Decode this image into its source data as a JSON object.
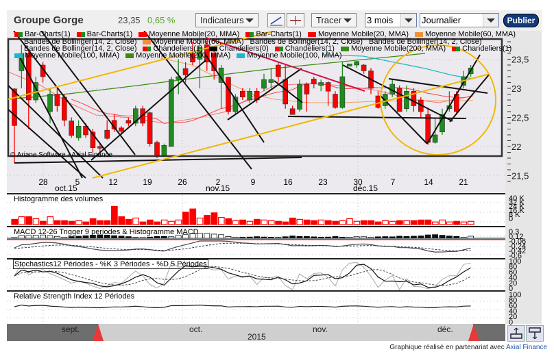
{
  "header": {
    "title": "Groupe Gorge",
    "price": "23,35",
    "change": "0,65 %",
    "indicators_label": "Indicateurs",
    "draw_label": "Tracer",
    "period_value": "3 mois",
    "interval_value": "Journalier",
    "publish_label": "Publier"
  },
  "legend": {
    "rows": [
      [
        {
          "label": "Bar-Charts(1)",
          "swatch": "rg"
        },
        {
          "label": "Bar-Charts(1)",
          "swatch": "rg"
        },
        {
          "label": "Moyenne Mobile(20, MMA)",
          "swatch": "#ff0000"
        },
        {
          "label": "Bar-Charts(1)",
          "swatch": "rg"
        },
        {
          "label": "Moyenne Mobile(20, MMA)",
          "swatch": "#ff0000"
        },
        {
          "label": "Moyenne Mobile(60, MMA)",
          "swatch": "#f0903a"
        }
      ],
      [
        {
          "label": "Bandes de Bollinger(14, 2, Close)",
          "swatch": ""
        },
        {
          "label": "Moyenne Mobile(60, MMA)",
          "swatch": "#f0903a"
        },
        {
          "label": "Bandes de Bollinger(14, 2, Close)",
          "swatch": ""
        },
        {
          "label": "Bandes de Bollinger(14, 2, Close)",
          "swatch": ""
        }
      ],
      [
        {
          "label": "Bandes de Bollinger(14, 2, Close)",
          "swatch": ""
        },
        {
          "label": "Chandeliers(1)",
          "swatch": "rg"
        },
        {
          "label": "Chandeliers(0)",
          "swatch": "#000000"
        },
        {
          "label": "Chandeliers(1)",
          "swatch": "rg"
        },
        {
          "label": "Moyenne Mobile(200, MMA)",
          "swatch": "#3a8a14"
        },
        {
          "label": "Chandeliers(1)",
          "swatch": "rg"
        }
      ],
      [
        {
          "label": "Moyenne Mobile(100, MMA)",
          "swatch": "#1ab8c8"
        },
        {
          "label": "Moyenne Mobile(200, MMA)",
          "swatch": "#3a8a14"
        },
        {
          "label": "Moyenne Mobile(100, MMA)",
          "swatch": "#1ab8c8"
        }
      ]
    ]
  },
  "copyright": "© Ariane Software - Axial Finance",
  "panels": {
    "volume_title": "Histogramme des volumes",
    "macd_title": "MACD 12-26   Trigger 9 periodes & Histogramme MACD",
    "stoch_title": "Stochastics12 Périodes  -  %K 3 Périodes  -  %D 5 Périodes",
    "rsi_title": "Relative Strength Index 12 Périodes"
  },
  "navigator": {
    "months": [
      "sept.",
      "oct.",
      "nov.",
      "déc."
    ],
    "year": "2015"
  },
  "footer": {
    "text": "Graphique réalisé en partenariat avec ",
    "link": "Axial Finance"
  },
  "colors": {
    "up": "#1e8c1e",
    "down": "#ff0000",
    "accent": "#123a7a",
    "change": "#5aa62a"
  },
  "chart_data": {
    "type": "candlestick",
    "title": "Groupe Gorge",
    "price_ticks": [
      "23,5",
      "23",
      "22,5",
      "22",
      "21,5"
    ],
    "price_tick_values": [
      23.5,
      23,
      22.5,
      22,
      21.5
    ],
    "ylim": [
      21.4,
      23.9
    ],
    "date_labels": [
      "28",
      "5",
      "12",
      "19",
      "26",
      "2",
      "9",
      "16",
      "23",
      "30",
      "7",
      "14",
      "21"
    ],
    "month_labels": [
      "oct.15",
      "nov.15",
      "déc.15"
    ],
    "candles_ohlc": [
      [
        22.99,
        23.0,
        21.72,
        22.36
      ],
      [
        23.3,
        23.75,
        23.0,
        23.6
      ],
      [
        23.6,
        23.65,
        22.3,
        22.8
      ],
      [
        22.8,
        23.2,
        22.75,
        23.1
      ],
      [
        23.4,
        23.45,
        23.1,
        23.2
      ],
      [
        22.6,
        23.0,
        22.4,
        22.9
      ],
      [
        22.9,
        23.0,
        22.6,
        22.7
      ],
      [
        22.85,
        22.9,
        22.35,
        22.45
      ],
      [
        22.44,
        22.5,
        22.15,
        22.19
      ],
      [
        22.15,
        22.45,
        22.1,
        22.35
      ],
      [
        22.35,
        22.4,
        22.15,
        22.2
      ],
      [
        22.25,
        22.3,
        21.9,
        21.98
      ],
      [
        22.0,
        22.05,
        21.9,
        21.97
      ],
      [
        22.28,
        22.45,
        22.12,
        22.14
      ],
      [
        22.45,
        22.55,
        22.25,
        22.3
      ],
      [
        22.32,
        22.35,
        22.2,
        22.26
      ],
      [
        22.45,
        22.5,
        22.35,
        22.4
      ],
      [
        22.4,
        22.7,
        22.35,
        22.65
      ],
      [
        22.65,
        22.7,
        22.35,
        22.4
      ],
      [
        22.58,
        22.6,
        22.0,
        22.05
      ],
      [
        22.07,
        22.1,
        21.8,
        21.85
      ],
      [
        21.85,
        22.05,
        21.85,
        22.02
      ],
      [
        22.0,
        23.2,
        22.0,
        23.15
      ],
      [
        23.15,
        23.5,
        22.9,
        23.2
      ],
      [
        23.34,
        23.45,
        23.1,
        23.23
      ],
      [
        23.6,
        23.8,
        23.4,
        23.45
      ],
      [
        23.5,
        23.9,
        23.0,
        23.7
      ],
      [
        23.75,
        23.8,
        23.3,
        23.45
      ],
      [
        23.6,
        23.65,
        23.15,
        23.3
      ],
      [
        23.1,
        23.4,
        22.65,
        23.35
      ],
      [
        23.19,
        23.2,
        22.55,
        22.6
      ],
      [
        22.6,
        22.9,
        22.55,
        22.85
      ],
      [
        22.95,
        23.0,
        22.8,
        22.85
      ],
      [
        22.8,
        23.0,
        22.75,
        22.95
      ],
      [
        22.95,
        23.0,
        22.75,
        22.8
      ],
      [
        23.0,
        23.25,
        22.95,
        23.15
      ],
      [
        23.1,
        23.35,
        23.0,
        23.15
      ],
      [
        23.4,
        23.45,
        23.1,
        23.2
      ],
      [
        23.15,
        23.4,
        22.65,
        22.73
      ],
      [
        22.65,
        22.7,
        22.55,
        22.55
      ],
      [
        22.64,
        23.15,
        22.6,
        23.07
      ],
      [
        23.07,
        23.1,
        22.6,
        22.9
      ],
      [
        23.16,
        23.2,
        23.0,
        23.08
      ],
      [
        23.05,
        23.15,
        22.95,
        23.1
      ],
      [
        23.1,
        23.12,
        22.7,
        22.95
      ],
      [
        22.9,
        22.95,
        22.65,
        22.67
      ],
      [
        22.67,
        23.45,
        22.65,
        23.2
      ],
      [
        23.38,
        23.42,
        23.38,
        23.42
      ],
      [
        23.4,
        23.47,
        23.35,
        23.46
      ],
      [
        23.4,
        23.42,
        23.25,
        23.3
      ],
      [
        23.3,
        23.35,
        22.9,
        23.0
      ],
      [
        22.87,
        22.95,
        22.65,
        22.67
      ],
      [
        22.7,
        22.95,
        22.65,
        22.9
      ],
      [
        22.9,
        23.15,
        22.85,
        23.07
      ],
      [
        23.0,
        23.05,
        22.6,
        22.6
      ],
      [
        22.65,
        23.05,
        22.6,
        22.95
      ],
      [
        22.95,
        23.0,
        22.6,
        22.7
      ],
      [
        22.8,
        22.85,
        22.5,
        22.6
      ],
      [
        22.55,
        22.65,
        22.03,
        22.07
      ],
      [
        22.07,
        22.5,
        22.05,
        22.2
      ],
      [
        22.25,
        22.65,
        22.2,
        22.55
      ],
      [
        22.65,
        22.95,
        22.6,
        22.7
      ],
      [
        22.9,
        22.95,
        22.55,
        22.6
      ],
      [
        23.05,
        23.3,
        23.0,
        23.2
      ],
      [
        23.25,
        23.4,
        23.2,
        23.35
      ]
    ],
    "volumes_k": [
      8,
      12,
      12,
      9,
      5,
      12,
      6,
      6,
      5,
      6,
      4,
      9,
      6,
      6,
      28,
      12,
      8,
      10,
      4,
      7,
      4,
      7,
      5,
      7,
      19,
      24,
      10,
      14,
      18,
      11,
      9,
      6,
      7,
      5,
      8,
      7,
      6,
      5,
      4,
      10,
      8,
      7,
      6,
      7,
      6,
      5,
      6,
      9,
      5,
      6,
      6,
      4,
      6,
      5,
      6,
      6,
      6,
      7,
      7,
      4,
      7,
      4,
      5,
      4,
      5
    ],
    "volume_ticks": [
      "40 K",
      "32 K",
      "24 K",
      "16 K",
      "8 K",
      "0"
    ],
    "macd_ticks": [
      "0,3",
      "0,12",
      "-0,06",
      "-0,24",
      "-0,42",
      "-0,6"
    ],
    "osc_ticks": [
      "100",
      "80",
      "60",
      "40",
      "20",
      "0"
    ]
  }
}
